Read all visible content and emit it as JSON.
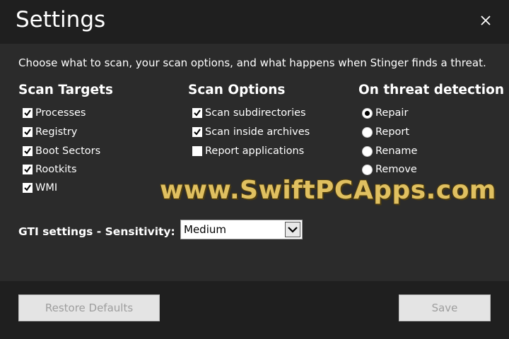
{
  "window": {
    "title": "Settings",
    "close_icon": "close-icon"
  },
  "description": "Choose what to scan, your scan options, and what happens when Stinger finds a threat.",
  "scan_targets": {
    "heading": "Scan Targets",
    "items": [
      {
        "label": "Processes",
        "checked": true
      },
      {
        "label": "Registry",
        "checked": true
      },
      {
        "label": "Boot Sectors",
        "checked": true
      },
      {
        "label": "Rootkits",
        "checked": true
      },
      {
        "label": "WMI",
        "checked": true
      }
    ]
  },
  "scan_options": {
    "heading": "Scan Options",
    "items": [
      {
        "label": "Scan subdirectories",
        "checked": true
      },
      {
        "label": "Scan inside archives",
        "checked": true
      },
      {
        "label": "Report applications",
        "checked": false
      }
    ]
  },
  "threat_detection": {
    "heading": "On threat detection",
    "items": [
      {
        "label": "Repair",
        "selected": true
      },
      {
        "label": "Report",
        "selected": false
      },
      {
        "label": "Rename",
        "selected": false
      },
      {
        "label": "Remove",
        "selected": false
      }
    ]
  },
  "gti": {
    "label": "GTI settings - Sensitivity:",
    "selected": "Medium"
  },
  "watermark": "www.SwiftPCApps.com",
  "footer": {
    "restore_label": "Restore Defaults",
    "save_label": "Save"
  },
  "colors": {
    "background": "#2b2b2b",
    "header_footer": "#1f1f1f",
    "button_bg": "#e4e4e4",
    "button_text_disabled": "#9e9e9e"
  }
}
